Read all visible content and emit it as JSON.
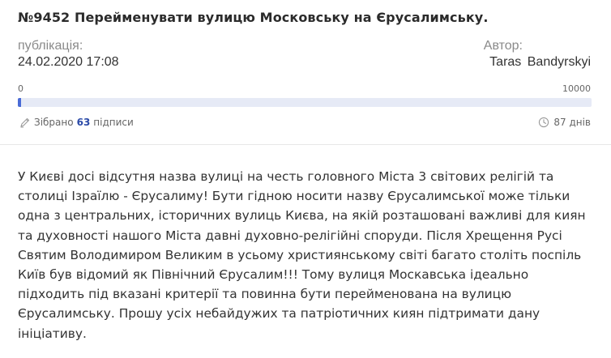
{
  "petition": {
    "title": "№9452 Перейменувати вулицю Московську на Єрусалимську.",
    "publication_label": "публікація:",
    "publication_date": "24.02.2020 17:08",
    "author_label": "Автор:",
    "author_name": "Taras  Bandyrskyi",
    "progress": {
      "min_label": "0",
      "max_label": "10000",
      "collected_prefix": "Зібрано",
      "collected_count": "63",
      "collected_suffix": "підписи",
      "signatures": 63,
      "goal": 10000,
      "days_left": "87 днів"
    },
    "text": "У Києві досі відсутня назва вулиці на честь головного Міста 3 світових релігій та столиці Ізраїлю - Єрусалиму! Бути гідною носити назву Єрусалимської може тільки одна з центральних, історичних вулиць Києва, на якій розташовані важливі для киян та духовності нашого Міста давні духовно-релігійні споруди. Після Хрещення Русі Святим Володимиром Великим в усьому християнському світі багато століть поспіль Київ був відомий як Північний Єрусалим!!! Тому вулиця Москавська ідеально підходить під вказані критерії та повинна бути перейменована на вулицю Єрусалимську. Прошу усіх небайдужих та патріотичних киян підтримати дану ініціативу."
  },
  "icons": {
    "signed": "pen-icon",
    "days": "clock-icon"
  },
  "colors": {
    "accent": "#2b4aa8",
    "progress_fill": "#4a6bd6",
    "progress_track": "#e6eaf6"
  }
}
